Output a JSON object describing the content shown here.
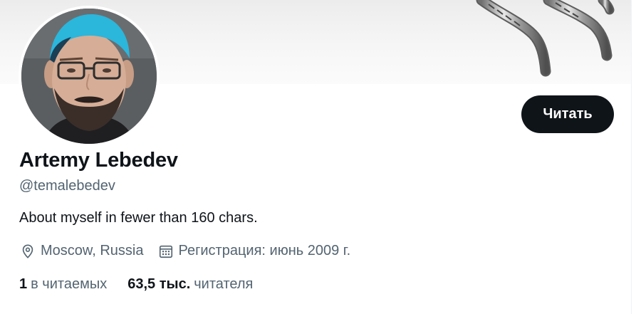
{
  "profile": {
    "display_name": "Artemy Lebedev",
    "username": "@temalebedev",
    "bio": "About myself in fewer than 160 chars.",
    "location": "Moscow, Russia",
    "joined": "Регистрация: июнь 2009 г.",
    "follow_label": "Читать",
    "following_count": "1",
    "following_label": "в читаемых",
    "followers_count": "63,5 тыс.",
    "followers_label": "читателя"
  },
  "icons": {
    "location": "location-pin-icon",
    "joined": "calendar-icon"
  },
  "colors": {
    "primary_text": "#0f1419",
    "secondary_text": "#536471",
    "button_bg": "#0f1419",
    "button_text": "#ffffff",
    "background": "#ffffff",
    "avatar_hair_accent": "#2bb6dc"
  }
}
